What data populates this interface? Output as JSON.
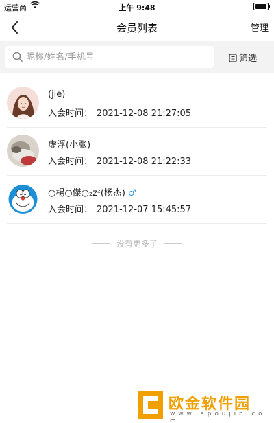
{
  "status_bar": {
    "carrier": "运营商",
    "time": "上午 9:48"
  },
  "nav": {
    "title": "会员列表",
    "manage_label": "管理"
  },
  "search": {
    "placeholder": "昵称/姓名/手机号",
    "filter_label": "筛选"
  },
  "members": [
    {
      "name": "(jie)",
      "gender": "",
      "joined_label": "入会时间：",
      "joined_at": "2021-12-08 21:27:05",
      "avatar": "woman-illustration"
    },
    {
      "name": "虚浮(小张)",
      "gender": "",
      "joined_label": "入会时间：",
      "joined_at": "2021-12-08 21:22:33",
      "avatar": "photo"
    },
    {
      "name": "○楊○傑○₂zᶻ(杨杰)",
      "gender": "♂",
      "joined_label": "入会时间：",
      "joined_at": "2021-12-07 15:45:57",
      "avatar": "doraemon"
    }
  ],
  "end_note": "没有更多了",
  "watermark": {
    "brand": "欧金软件园",
    "url": "w w w . a p o u j i n . c o m"
  },
  "colors": {
    "gender_male": "#3aa0e0",
    "watermark": "#f0a000",
    "search_bg": "#f3f3f3"
  }
}
